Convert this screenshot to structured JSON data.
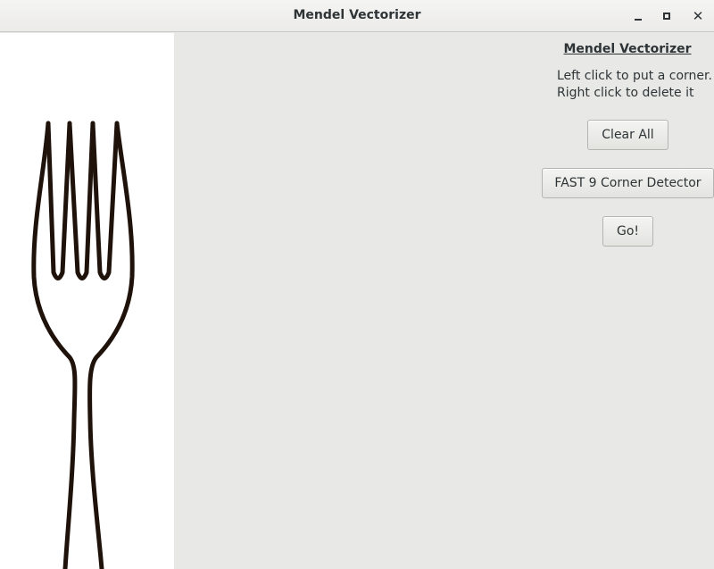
{
  "window": {
    "title": "Mendel Vectorizer",
    "controls": [
      "minimize-icon",
      "maximize-icon",
      "close-icon"
    ],
    "close_glyph": "✕"
  },
  "canvas": {
    "image": "fork-icon"
  },
  "panel": {
    "title": "Mendel Vectorizer",
    "instruction_1": "Left click to put a corner.",
    "instruction_2": "Right click to delete it",
    "clear_label": "Clear All",
    "fast_label": "FAST 9 Corner Detector",
    "go_label": "Go!"
  },
  "colors": {
    "titlebar": "#ecebe9",
    "panel": "#e8e8e7",
    "canvas": "#ffffff",
    "fork_stroke": "#1e120a"
  }
}
